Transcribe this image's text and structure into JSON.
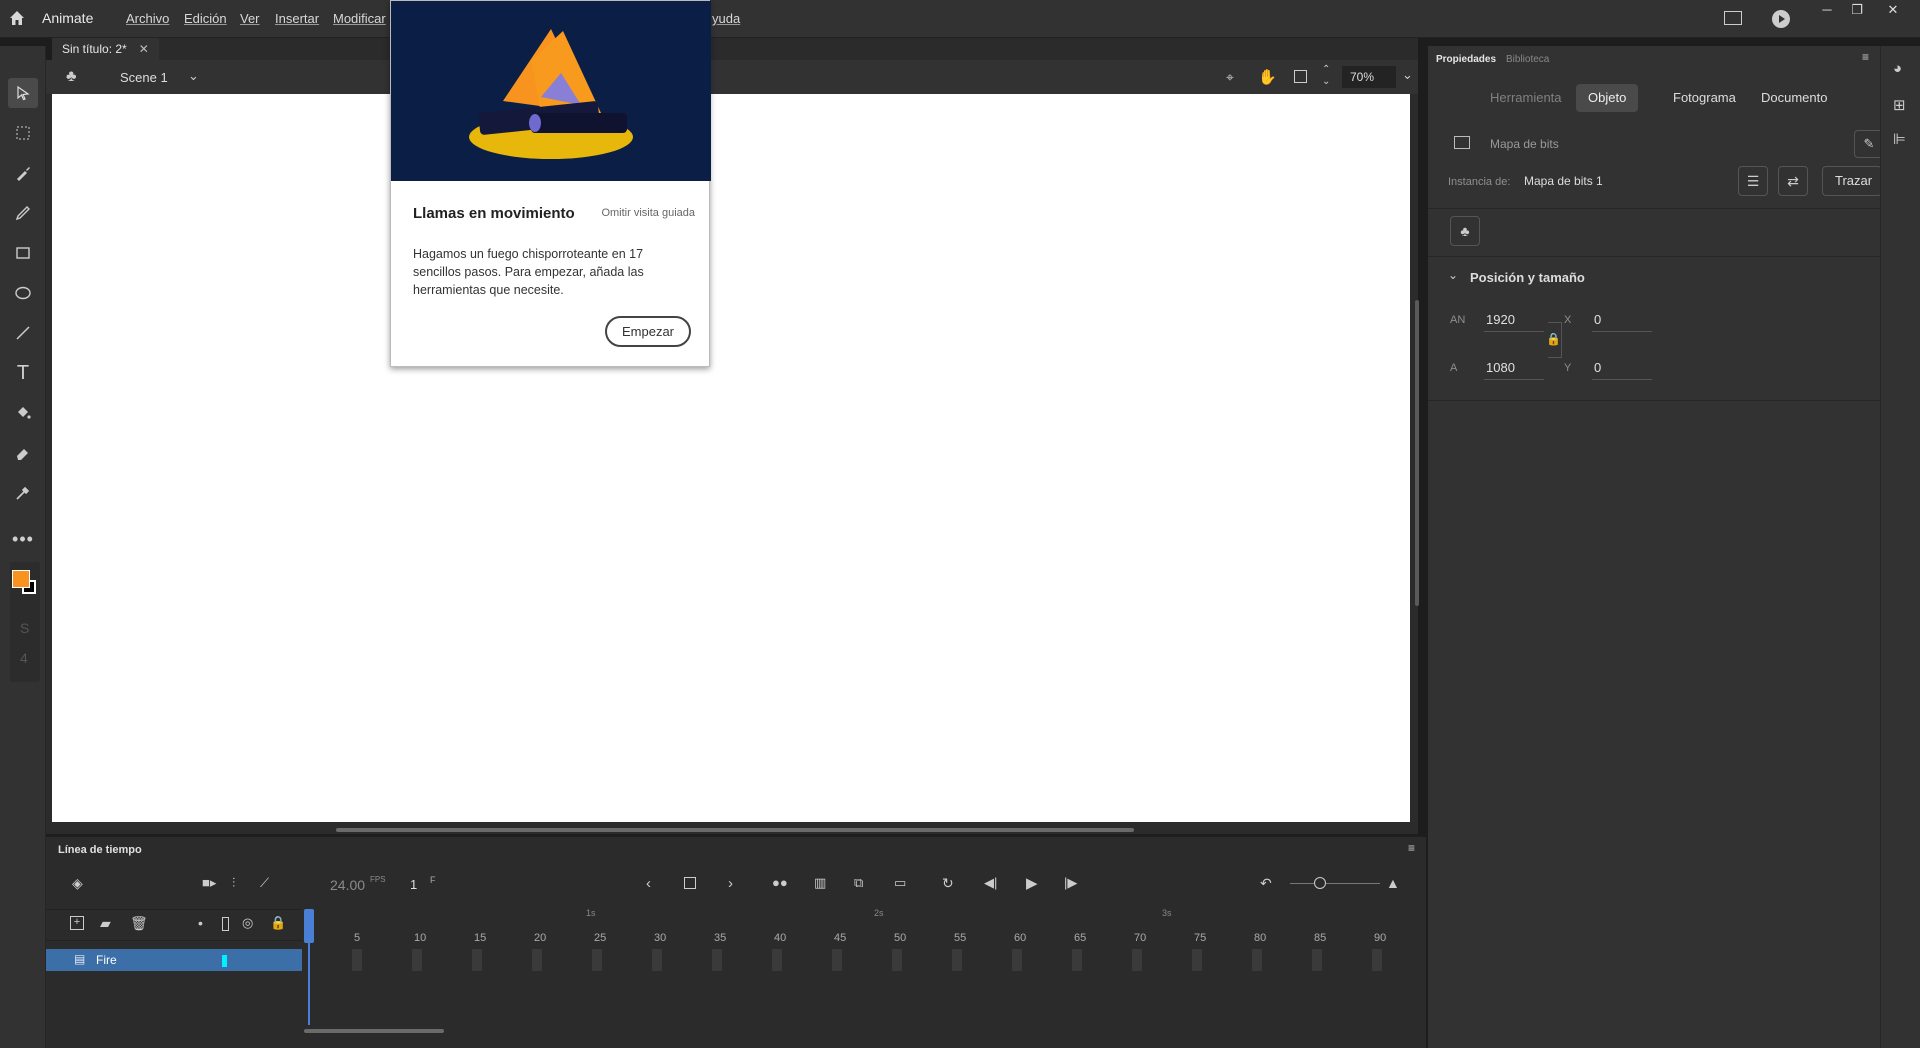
{
  "menubar": {
    "app_name": "Animate",
    "items": [
      "Archivo",
      "Edición",
      "Ver",
      "Insertar",
      "Modificar",
      "yuda"
    ]
  },
  "document": {
    "tab_title": "Sin título: 2*",
    "scene": "Scene 1",
    "zoom": "70%"
  },
  "coach": {
    "title": "Llamas en movimiento",
    "skip": "Omitir visita guiada",
    "body": "Hagamos un fuego chisporroteante en 17 sencillos pasos. Para empezar, añada las herramientas que necesite.",
    "start": "Empezar"
  },
  "props": {
    "panel_tabs": [
      "Propiedades",
      "Biblioteca"
    ],
    "tabs": [
      "Herramienta",
      "Objeto",
      "Fotograma",
      "Documento"
    ],
    "active_tab": "Objeto",
    "object_type": "Mapa de bits",
    "instance_label": "Instancia de:",
    "instance_value": "Mapa de bits 1",
    "trace_button": "Trazar",
    "section_title": "Posición y tamaño",
    "w_label": "AN",
    "w_value": "1920",
    "h_label": "A",
    "h_value": "1080",
    "x_label": "X",
    "x_value": "0",
    "y_label": "Y",
    "y_value": "0"
  },
  "timeline": {
    "title": "Línea de tiempo",
    "fps": "24.00",
    "fps_unit": "FPS",
    "frame": "1",
    "frame_unit": "F",
    "layer_name": "Fire",
    "frame_numbers": [
      "5",
      "10",
      "15",
      "20",
      "25",
      "30",
      "35",
      "40",
      "45",
      "50",
      "55",
      "60",
      "65",
      "70",
      "75",
      "80",
      "85",
      "90"
    ],
    "second_markers": [
      "1s",
      "2s",
      "3s"
    ]
  },
  "colors": {
    "fill": "#f7931e",
    "stroke": "#000000",
    "layer_highlight": "#3c6fa8",
    "playhead": "#4a7fd6"
  }
}
